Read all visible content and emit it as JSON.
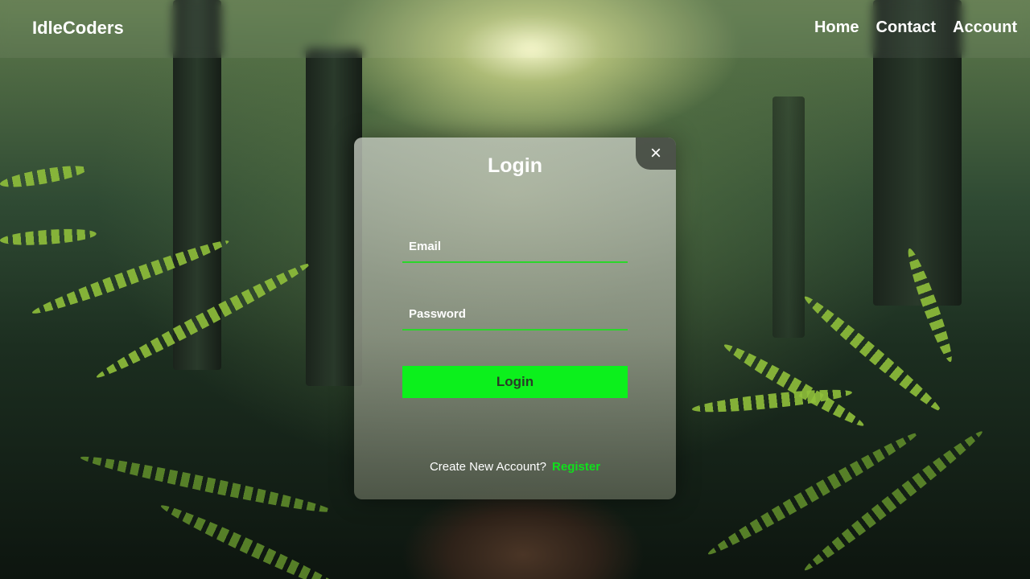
{
  "header": {
    "brand": "IdleCoders",
    "nav": [
      {
        "label": "Home"
      },
      {
        "label": "Contact"
      },
      {
        "label": "Account"
      }
    ]
  },
  "modal": {
    "title": "Login",
    "close_icon": "×",
    "email_label": "Email",
    "password_label": "Password",
    "email_value": "",
    "password_value": "",
    "submit_label": "Login",
    "register_prompt": "Create New Account?",
    "register_link": "Register"
  },
  "colors": {
    "accent": "#0cf01c",
    "field_underline": "#2ad62a",
    "link": "#10e01c",
    "text": "#ffffff"
  },
  "icons": {
    "close": "close-icon"
  }
}
